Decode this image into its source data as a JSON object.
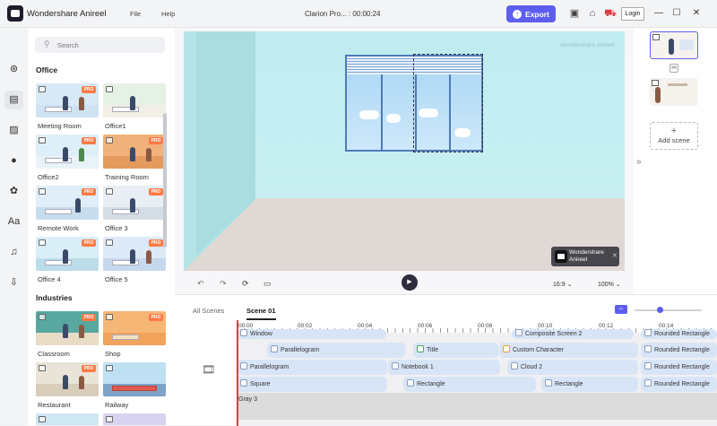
{
  "app": {
    "name": "Wondershare Anireel",
    "menus": [
      "File",
      "Help"
    ],
    "project_title": "Clarion Pro... : 00:00:24",
    "export_label": "Export",
    "login_label": "Login"
  },
  "colors": {
    "accent": "#5d5ef0",
    "pro_badge": "#ff7a45",
    "playhead": "#e03c3c"
  },
  "search": {
    "placeholder": "Search"
  },
  "sections": [
    {
      "title": "Office",
      "items": [
        {
          "label": "Meeting Room",
          "pro": "PRO"
        },
        {
          "label": "Office1",
          "pro": ""
        },
        {
          "label": "Office2",
          "pro": "PRO"
        },
        {
          "label": "Training Room",
          "pro": "PRO"
        },
        {
          "label": "Remote Work",
          "pro": "PRO"
        },
        {
          "label": "Office 3",
          "pro": "PRO"
        },
        {
          "label": "Office 4",
          "pro": "PRO"
        },
        {
          "label": "Office 5",
          "pro": "PRO"
        }
      ]
    },
    {
      "title": "Industries",
      "items": [
        {
          "label": "Classroom",
          "pro": "PRO"
        },
        {
          "label": "Shop",
          "pro": "PRO"
        },
        {
          "label": "Restaurant",
          "pro": "PRO"
        },
        {
          "label": "Railway",
          "pro": ""
        }
      ]
    }
  ],
  "watermark": {
    "line1": "Wondershare",
    "line2": "Anireel",
    "ghost": "Wondershare Anireel"
  },
  "player": {
    "aspect": "16:9",
    "zoom": "100%"
  },
  "scenes_panel": {
    "add_label": "Add scene",
    "plus": "+"
  },
  "timeline": {
    "tabs": [
      "All Scenes",
      "Scene 01"
    ],
    "ticks": [
      "00:00",
      "00:02",
      "00:04",
      "00:06",
      "00:08",
      "00:10",
      "00:12",
      "00:14"
    ],
    "clips": {
      "window": "Window",
      "composite": "Composite Screen 2",
      "parallelogram1": "Parallelogram",
      "title": "Title",
      "custom_character": "Custom Character",
      "rounded_rect1": "Rounded Rectangle",
      "parallelogram2": "Parallelogram",
      "notebook": "Notebook 1",
      "cloud": "Cloud 2",
      "rounded_rect2": "Rounded Rectangle",
      "square": "Square",
      "rectangle1": "Rectangle",
      "rectangle2": "Rectangle",
      "rounded_rect3": "Rounded Rectangle"
    },
    "background_track": "Gray 3"
  }
}
